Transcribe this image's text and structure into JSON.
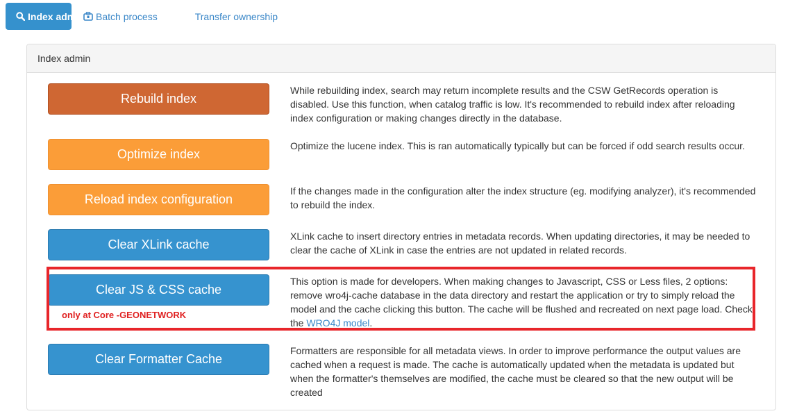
{
  "tabs": [
    {
      "label": "Index admin",
      "icon": "search-icon",
      "active": true
    },
    {
      "label": "Batch process",
      "icon": "briefcase-icon",
      "active": false
    },
    {
      "label": "Transfer ownership",
      "icon": "",
      "active": false
    }
  ],
  "panel": {
    "title": "Index admin",
    "rows": [
      {
        "button": "Rebuild index",
        "style": "danger",
        "description": "While rebuilding index, search may return incomplete results and the CSW GetRecords operation is disabled. Use this function, when catalog traffic is low. It's recommended to rebuild index after reloading index configuration or making changes directly in the database."
      },
      {
        "button": "Optimize index",
        "style": "warning",
        "description": "Optimize the lucene index. This is ran automatically typically but can be forced if odd search results occur."
      },
      {
        "button": "Reload index configuration",
        "style": "warning",
        "description": "If the changes made in the configuration alter the index structure (eg. modifying analyzer), it's recommended to rebuild the index."
      },
      {
        "button": "Clear XLink cache",
        "style": "primary",
        "description": "XLink cache to insert directory entries in metadata records. When updating directories, it may be needed to clear the cache of XLink in case the entries are not updated in related records."
      },
      {
        "button": "Clear JS & CSS cache",
        "style": "primary",
        "description": "This option is made for developers. When making changes to Javascript, CSS or Less files, 2 options: remove wro4j-cache database in the data directory and restart the application or try to simply reload the model and the cache clicking this button. The cache will be flushed and recreated on next page load. Check the",
        "link_text": "WRO4J model",
        "after_link": "."
      },
      {
        "button": "Clear Formatter Cache",
        "style": "primary",
        "description": "Formatters are responsible for all metadata views. In order to improve performance the output values are cached when a request is made. The cache is automatically updated when the metadata is updated but when the formatter's themselves are modified, the cache must be cleared so that the new output will be created"
      }
    ]
  },
  "annotation": {
    "text": "only at Core -GEONETWORK",
    "color": "#e02020"
  },
  "colors": {
    "primary": "#3693cf",
    "warning": "#fb9d38",
    "danger": "#cf6733",
    "link": "#3a87c8",
    "highlight": "#e8262b"
  }
}
